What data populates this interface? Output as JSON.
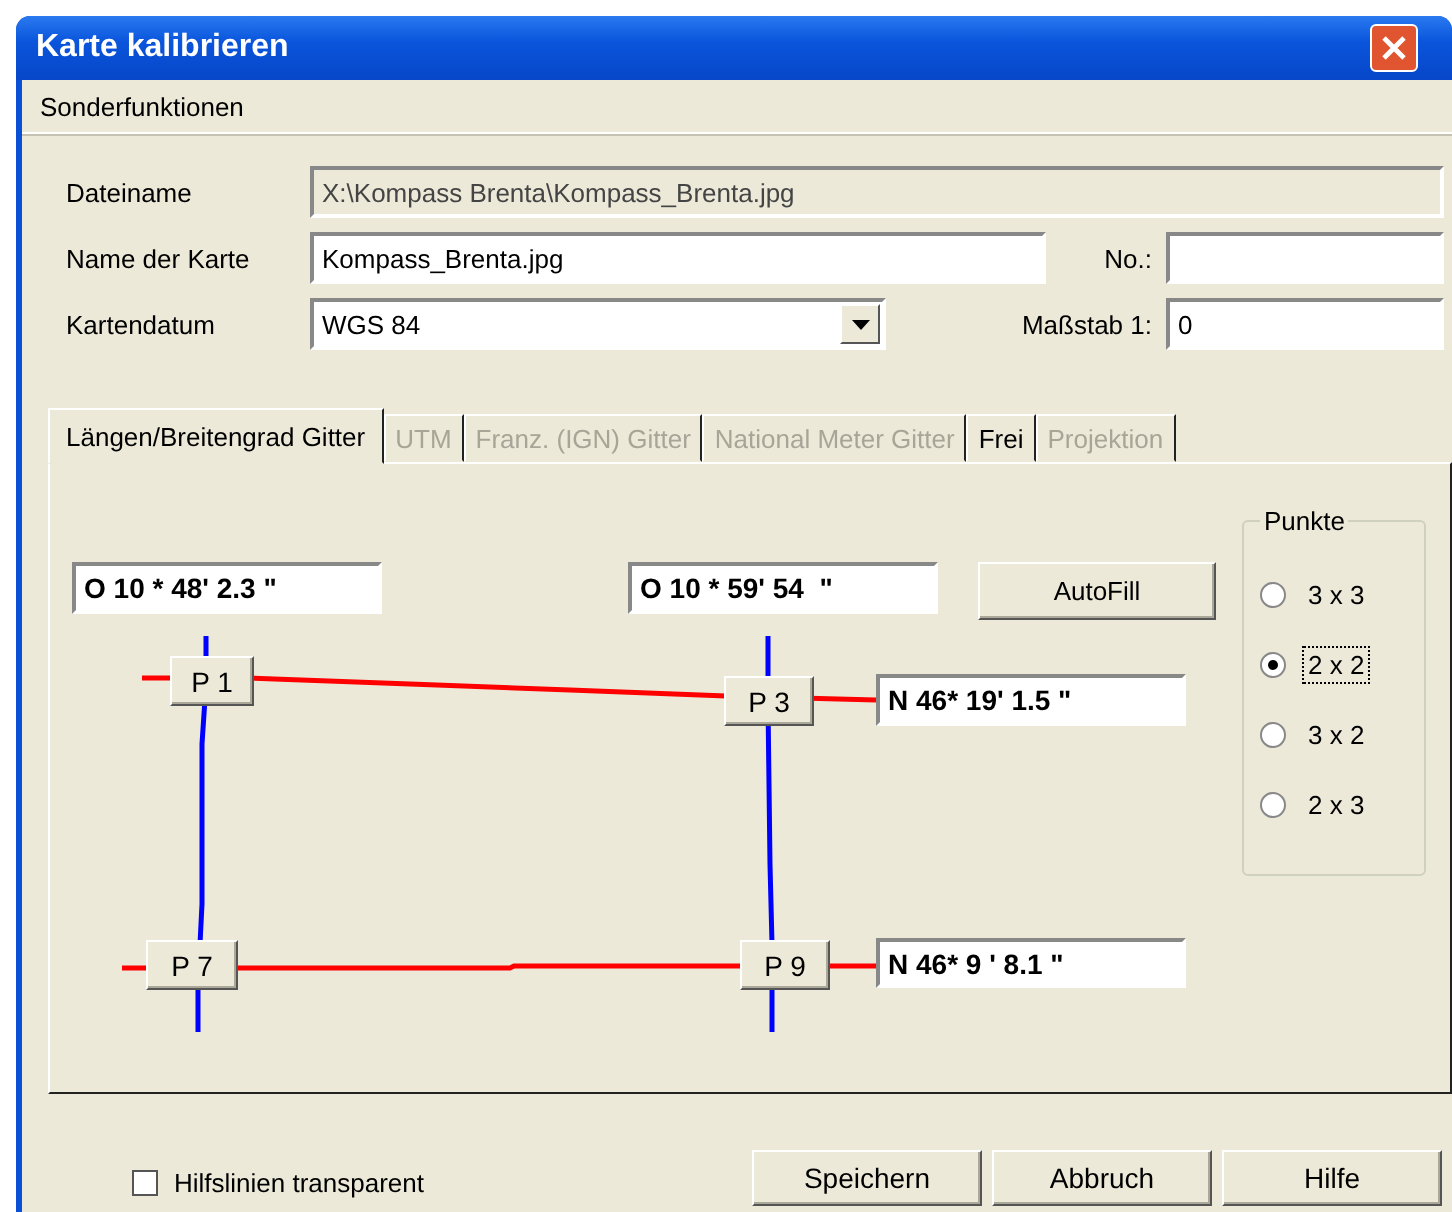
{
  "window": {
    "title": "Karte kalibrieren"
  },
  "menu": [
    {
      "label": "Sonderfunktionen"
    }
  ],
  "form": {
    "file_label": "Dateiname",
    "file_value": "X:\\Kompass Brenta\\Kompass_Brenta.jpg",
    "map_name_label": "Name der Karte",
    "map_name_value": "Kompass_Brenta.jpg",
    "no_label": "No.:",
    "datum_label": "Kartendatum",
    "datum_value": "WGS 84",
    "scale_label": "Maßstab 1:",
    "scale_value": "0"
  },
  "tabs": [
    {
      "label": "Längen/Breitengrad Gitter",
      "selected": true,
      "disabled": false
    },
    {
      "label": "UTM",
      "selected": false,
      "disabled": true
    },
    {
      "label": "Franz. (IGN) Gitter",
      "selected": false,
      "disabled": true
    },
    {
      "label": "National Meter Gitter",
      "selected": false,
      "disabled": true
    },
    {
      "label": "Frei",
      "selected": false,
      "disabled": false
    },
    {
      "label": "Projektion",
      "selected": false,
      "disabled": true
    }
  ],
  "grid": {
    "lon_left": "O 10 * 48' 2.3 \"",
    "lon_right": "O 10 * 59' 54  \"",
    "lat_top": "N 46* 19' 1.5 \"",
    "lat_bottom": "N 46* 9 ' 8.1 \"",
    "autofill": "AutoFill",
    "points": [
      {
        "label": "P 1"
      },
      {
        "label": "P 3"
      },
      {
        "label": "P 7"
      },
      {
        "label": "P 9"
      }
    ]
  },
  "punkte": {
    "title": "Punkte",
    "options": [
      {
        "label": "3 x 3",
        "selected": false
      },
      {
        "label": "2 x 2",
        "selected": true
      },
      {
        "label": "3 x 2",
        "selected": false
      },
      {
        "label": "2 x 3",
        "selected": false
      }
    ]
  },
  "checkbox": {
    "label": "Hilfslinien transparent",
    "checked": false
  },
  "buttons": [
    {
      "label": "Speichern"
    },
    {
      "label": "Abbruch"
    },
    {
      "label": "Hilfe"
    }
  ]
}
